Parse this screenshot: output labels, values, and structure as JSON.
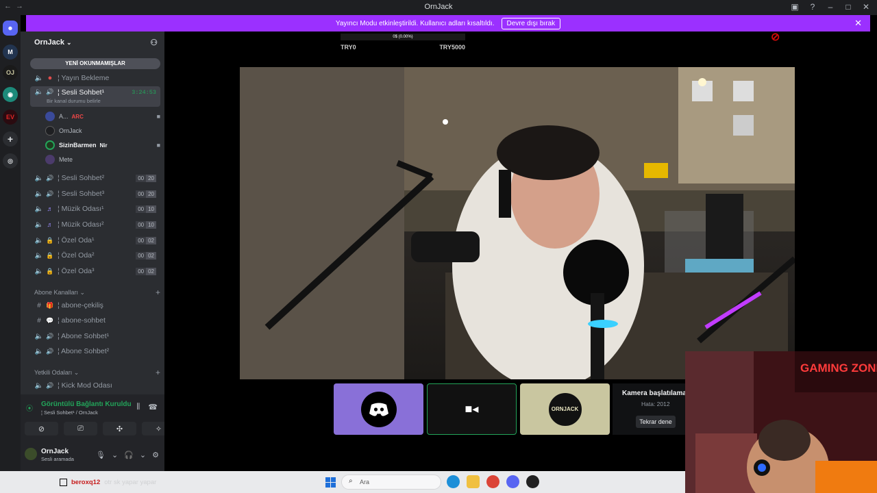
{
  "window": {
    "title": "OrnJack"
  },
  "notice": {
    "text": "Yayıncı Modu etkinleştirildi. Kullanıcı adları kısaltıldı.",
    "button": "Devre dışı bırak"
  },
  "server": {
    "name": "OrnJack"
  },
  "sidebar": {
    "unread_label": "YENİ OKUNMAMIŞLAR",
    "channels": [
      {
        "name": "¦ Yayın Bekleme",
        "icon": "live-dot-icon"
      },
      {
        "name": "¦ Sesli Sohbet¹",
        "time": "3:24:53",
        "status": "Bir kanal durumu belirle"
      },
      {
        "name": "¦ Sesli Sohbet²",
        "count_a": "00",
        "count_b": "20"
      },
      {
        "name": "¦ Sesli Sohbet³",
        "count_a": "00",
        "count_b": "20"
      },
      {
        "name": "¦ Müzik Odası¹",
        "count_a": "00",
        "count_b": "10"
      },
      {
        "name": "¦ Müzik Odası²",
        "count_a": "00",
        "count_b": "10"
      },
      {
        "name": "¦ Özel Oda¹",
        "count_a": "00",
        "count_b": "02"
      },
      {
        "name": "¦ Özel Oda²",
        "count_a": "00",
        "count_b": "02"
      },
      {
        "name": "¦ Özel Oda³",
        "count_a": "00",
        "count_b": "02"
      }
    ],
    "users": [
      {
        "name": "A...",
        "tag": "ARC"
      },
      {
        "name": "OrnJack",
        "tag": ""
      },
      {
        "name": "SizinBarmen",
        "tag": "Nir"
      },
      {
        "name": "Mete",
        "tag": ""
      }
    ],
    "category_abone": "Abone Kanalları",
    "abone_channels": [
      "¦ abone-çekiliş",
      "¦ abone-sohbet",
      "¦ Abone Sohbet¹",
      "¦ Abone Sohbet²"
    ],
    "category_yetkili": "Yetkili Odaları",
    "yetkili_channels": [
      "¦ Kick Mod Odası"
    ]
  },
  "voice": {
    "status": "Görüntülü Bağlantı Kuruldu",
    "path": "¦ Sesli Sohbet¹ / OrnJack",
    "user": "OrnJack",
    "user_status": "Sesli aramada"
  },
  "overlay": {
    "progress_text": "0$ (0.00%)",
    "progress_fraction": 0.0,
    "left_label": "TRY0",
    "right_label": "TRY5000"
  },
  "stage": {
    "tile3_label": "ORNJACK",
    "camera_error_title": "Kamera başlatılama",
    "camera_error_code": "Hata: 2012",
    "retry": "Tekrar dene"
  },
  "taskbar": {
    "chat_user": "beroxq12",
    "chat_msg": "otr sk yapar yapar",
    "search_placeholder": "Ara"
  },
  "facecam": {
    "sign": "GAMING ZONE"
  },
  "colors": {
    "accent": "#9b30ff",
    "green": "#23a55a",
    "blurple": "#5865f2"
  }
}
